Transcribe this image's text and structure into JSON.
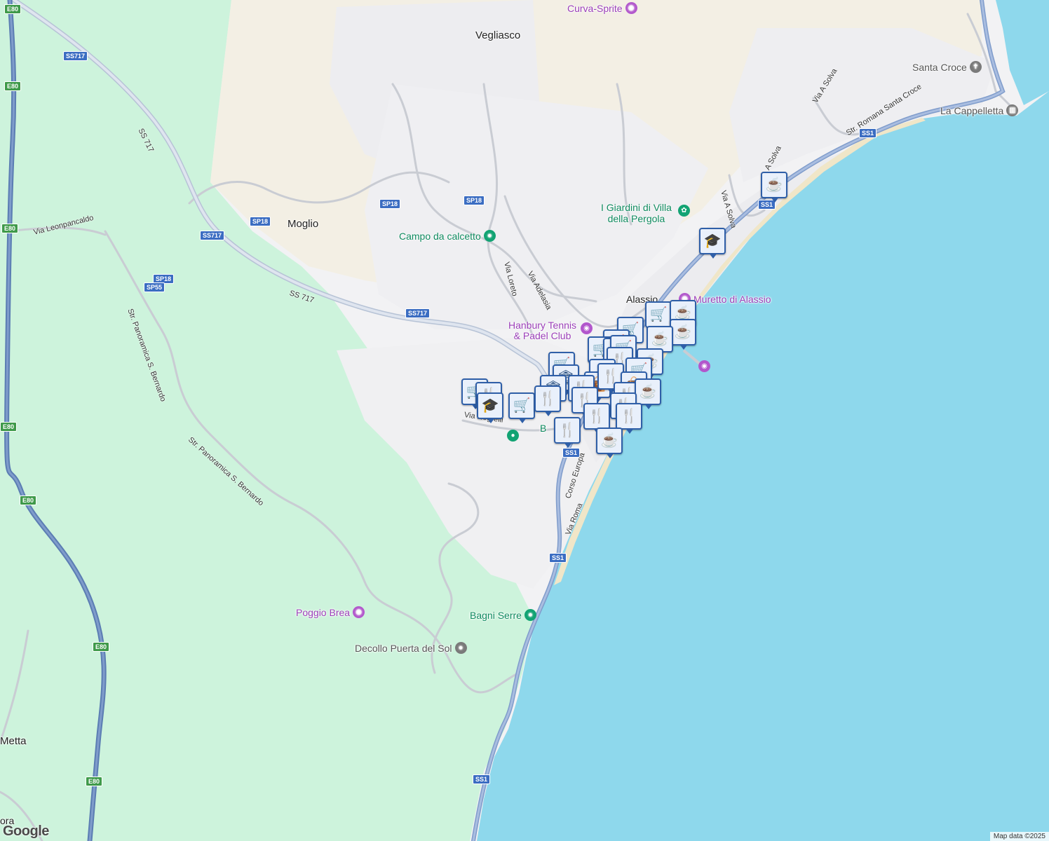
{
  "places": {
    "vegliasco": "Vegliasco",
    "moglio": "Moglio",
    "metta": "Metta",
    "alassio": "Alassio",
    "ora": "ora"
  },
  "pois": {
    "curva_sprite": "Curva-Sprite",
    "santa_croce": "Santa Croce",
    "la_cappelletta": "La Cappelletta",
    "giardini_line1": "I Giardini di Villa",
    "giardini_line2": "della Pergola",
    "campo_calcetto": "Campo da calcetto",
    "muretto": "Muretto di Alassio",
    "hanbury_line1": "Hanbury Tennis",
    "hanbury_line2": "& Padel Club",
    "bagni_serre": "Bagni Serre",
    "poggio_brea": "Poggio Brea",
    "decollo": "Decollo Puerta del Sol",
    "b_partial": "B"
  },
  "streets": {
    "via_leonpancaldo": "Via Leonpancaldo",
    "ss717_a": "SS 717",
    "ss717_b": "SS 717",
    "via_loreto": "Via Loreto",
    "via_adelasia": "Via Adelasia",
    "str_panoramica_1": "Str. Panoramica S. Bernardo",
    "str_panoramica_2": "Str. Panoramica S. Bernardo",
    "via_a_solva_1": "Via A Solva",
    "via_a_solva_2": "Via A Solva",
    "via_a_solva_3": "A Solva",
    "str_romana": "Str. Romana Santa Croce",
    "via_negrelli": "Via Negrelli",
    "corso_europa": "Corso Europa",
    "via_roma": "Via Roma"
  },
  "shields": {
    "e80_1": "E80",
    "e80_2": "E80",
    "e80_3": "E80",
    "e80_4": "E80",
    "e80_5": "E80",
    "e80_6": "E80",
    "e80_7": "E80",
    "ss717_1": "SS717",
    "ss717_2": "SS717",
    "ss717_3": "SS717",
    "sp18_1": "SP18",
    "sp18_2": "SP18",
    "sp18_3": "SP18",
    "sp18_4": "SP18",
    "sp55": "SP55",
    "ss1_1": "SS1",
    "ss1_2": "SS1",
    "ss1_3": "SS1",
    "ss1_4": "SS1",
    "ss1_5": "SS1"
  },
  "markers": [
    {
      "icon": "coffee-icon",
      "glyph": "☕"
    },
    {
      "icon": "school-icon",
      "glyph": "🎓"
    },
    {
      "icon": "cart-icon",
      "glyph": "🛒"
    },
    {
      "icon": "coffee-icon",
      "glyph": "☕"
    },
    {
      "icon": "cart-icon",
      "glyph": "🛒"
    },
    {
      "icon": "coffee-icon",
      "glyph": "☕"
    },
    {
      "icon": "cart-icon",
      "glyph": "🛒"
    },
    {
      "icon": "coffee-icon",
      "glyph": "☕"
    },
    {
      "icon": "cart-icon",
      "glyph": "🛒"
    },
    {
      "icon": "restaurant-icon",
      "glyph": "🍴"
    },
    {
      "icon": "cart-icon",
      "glyph": "🛒"
    },
    {
      "icon": "restaurant-icon",
      "glyph": "🍴"
    },
    {
      "icon": "coffee-icon",
      "glyph": "☕"
    },
    {
      "icon": "cart-icon",
      "glyph": "🛒"
    },
    {
      "icon": "cart-icon",
      "glyph": "🛒"
    },
    {
      "icon": "museum-icon",
      "glyph": "🏛"
    },
    {
      "icon": "restaurant-icon",
      "glyph": "🍴"
    },
    {
      "icon": "shopping-bag-icon",
      "glyph": "👜"
    },
    {
      "icon": "restaurant-icon",
      "glyph": "🍴"
    },
    {
      "icon": "restaurant-icon",
      "glyph": "🍴"
    },
    {
      "icon": "shopping-bag-icon",
      "glyph": "👜"
    },
    {
      "icon": "restaurant-icon",
      "glyph": "🍴"
    },
    {
      "icon": "restaurant-icon",
      "glyph": "🍴"
    },
    {
      "icon": "coffee-icon",
      "glyph": "☕"
    },
    {
      "icon": "cart-icon",
      "glyph": "🛒"
    },
    {
      "icon": "restaurant-icon",
      "glyph": "🍴"
    },
    {
      "icon": "school-icon",
      "glyph": "🎓"
    },
    {
      "icon": "cart-icon",
      "glyph": "🛒"
    },
    {
      "icon": "museum-icon",
      "glyph": "🏛"
    },
    {
      "icon": "restaurant-icon",
      "glyph": "🍴"
    },
    {
      "icon": "restaurant-icon",
      "glyph": "🍴"
    },
    {
      "icon": "restaurant-icon",
      "glyph": "🍴"
    },
    {
      "icon": "restaurant-icon",
      "glyph": "🍴"
    },
    {
      "icon": "restaurant-icon",
      "glyph": "🍴"
    },
    {
      "icon": "coffee-icon",
      "glyph": "☕"
    }
  ],
  "logo": "Google",
  "attribution": "Map data ©2025",
  "colors": {
    "sea": "#8ed8ec",
    "land": "#f2f2f4",
    "forest": "#cdf3dc",
    "urban": "#f3efe4",
    "highway": "#7f9ccb",
    "marker_border": "#2f5fa8"
  }
}
